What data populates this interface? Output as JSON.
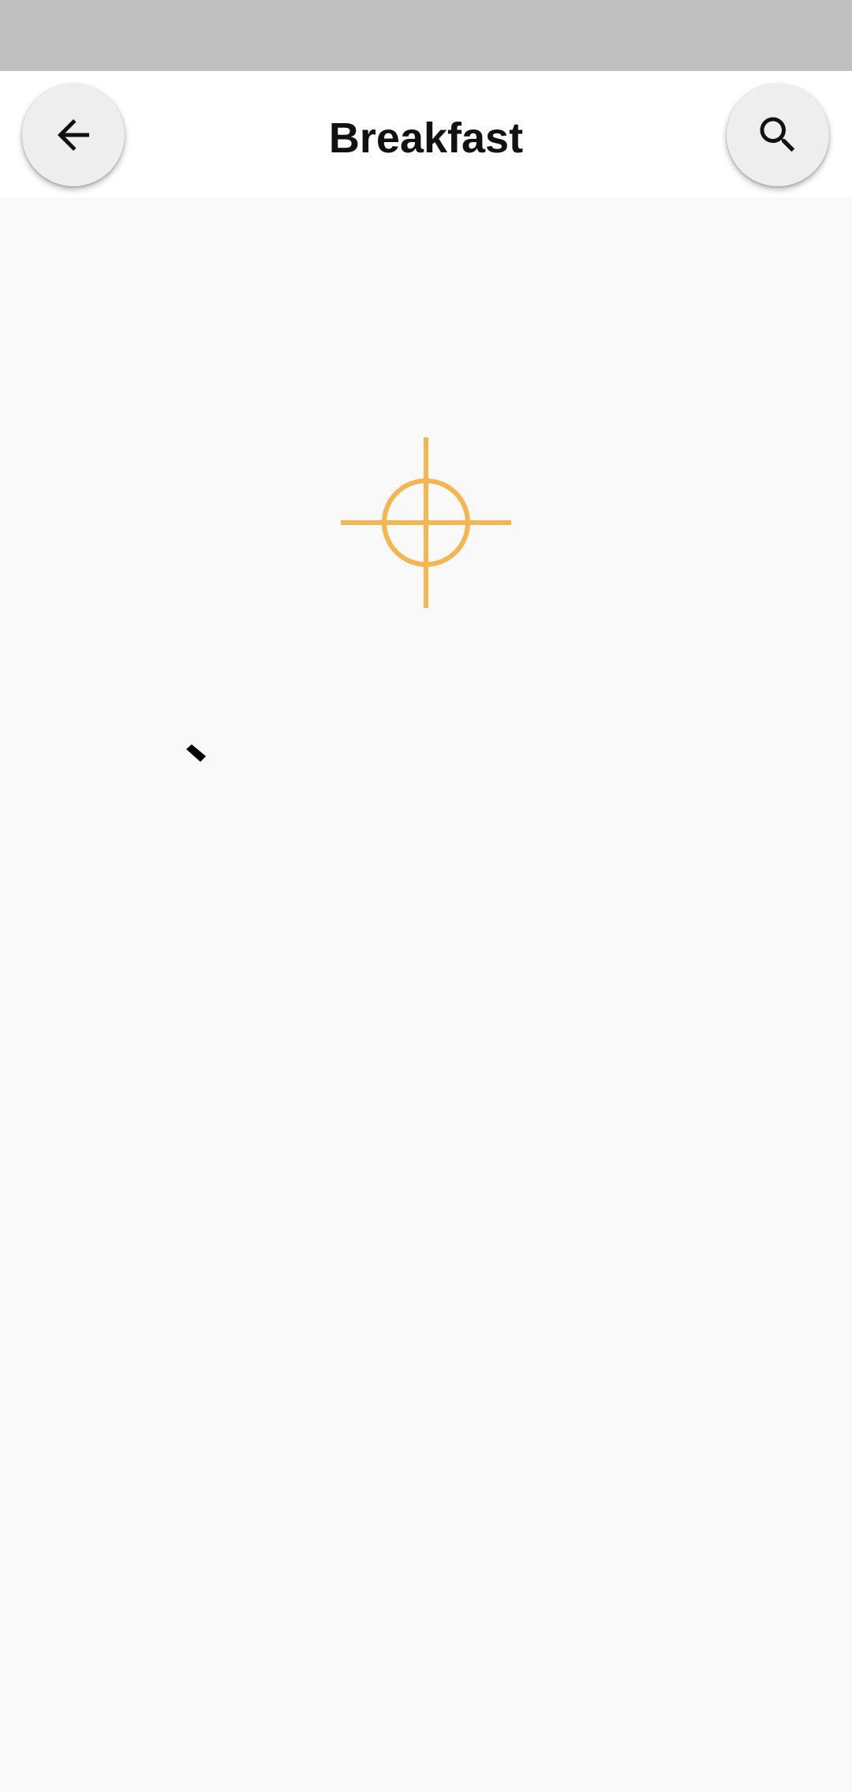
{
  "header": {
    "title": "Breakfast"
  },
  "icons": {
    "back": "arrow-left-icon",
    "search": "search-icon",
    "center_marker": "crosshair-icon"
  },
  "colors": {
    "status_bar": "#bfbfbf",
    "app_bar": "#ffffff",
    "background": "#f9f9f9",
    "button": "#eeeeee",
    "crosshair": "#f7b54f"
  }
}
